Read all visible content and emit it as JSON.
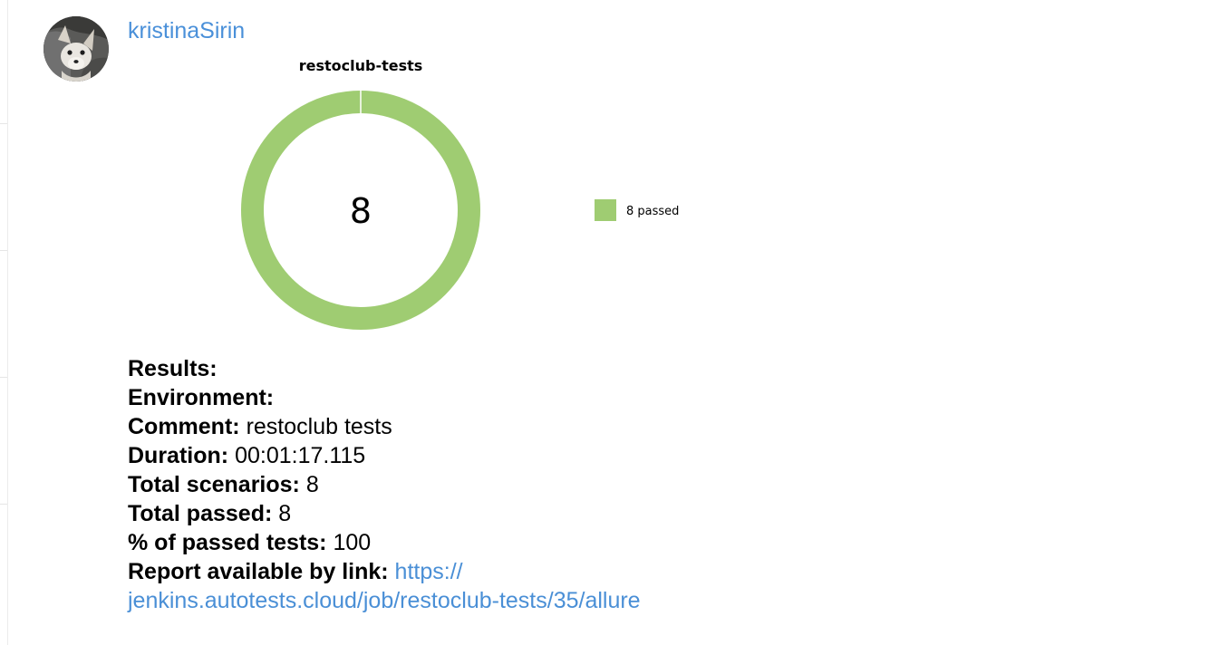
{
  "message": {
    "author": "kristinaSirin",
    "avatar_icon": "fennec-fox-avatar"
  },
  "chart_data": {
    "type": "pie",
    "variant": "donut",
    "title": "restoclub-tests",
    "center_label": "8",
    "categories": [
      "8 passed"
    ],
    "values": [
      8
    ],
    "colors": [
      "#9fcc72"
    ],
    "legend_position": "right"
  },
  "report": {
    "results_label": "Results:",
    "environment_label": "Environment:",
    "comment_label": "Comment:",
    "comment_value": "restoclub tests",
    "duration_label": "Duration:",
    "duration_value": "00:01:17.115",
    "total_scenarios_label": "Total scenarios:",
    "total_scenarios_value": "8",
    "total_passed_label": "Total passed:",
    "total_passed_value": "8",
    "percent_label": "% of passed tests:",
    "percent_value": "100",
    "link_label": "Report available by link:",
    "link_line1": "https://",
    "link_line2": "jenkins.autotests.cloud/job/restoclub-tests/35/allure"
  }
}
